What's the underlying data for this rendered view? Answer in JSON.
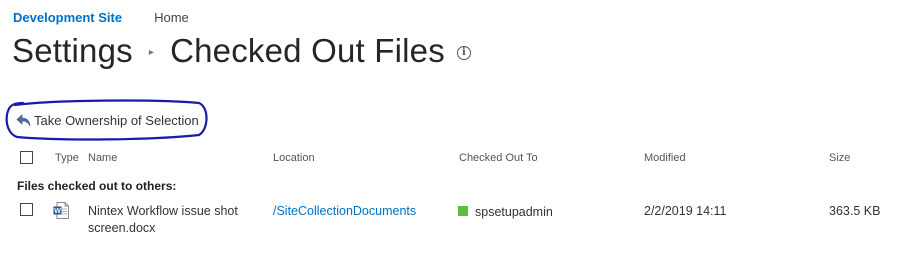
{
  "nav": {
    "site": "Development Site",
    "home": "Home"
  },
  "title": {
    "parent": "Settings",
    "separator": "▸",
    "current": "Checked Out Files",
    "info_glyph": "i"
  },
  "toolbar": {
    "take_ownership_label": "Take Ownership of Selection",
    "icon": "reply-arrow-icon"
  },
  "table": {
    "columns": {
      "type": "Type",
      "name": "Name",
      "location": "Location",
      "checked_out_to": "Checked Out To",
      "modified": "Modified",
      "size": "Size"
    },
    "group_label": "Files checked out to others:",
    "rows": [
      {
        "type_icon": "word-document-icon",
        "name_line1": "Nintex Workflow issue shot",
        "name_line2": "screen.docx",
        "location": "/SiteCollectionDocuments",
        "checked_out_to": "spsetupadmin",
        "modified": "2/2/2019 14:11",
        "size": "363.5 KB"
      }
    ]
  },
  "colors": {
    "accent": "#0072c6",
    "presence": "#5cbf3c",
    "annotation": "#1a1aa8"
  }
}
